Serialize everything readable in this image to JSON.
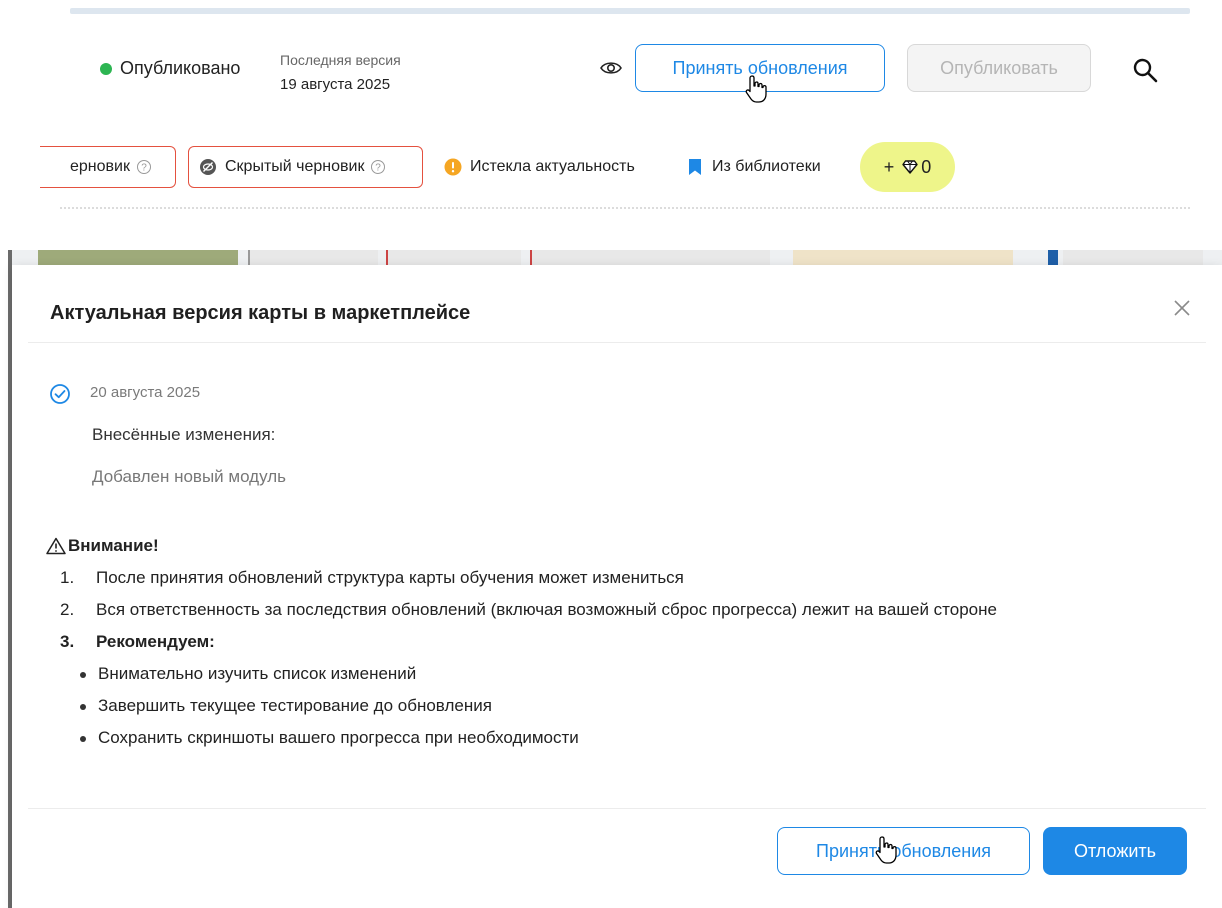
{
  "header": {
    "status_label": "Опубликовано",
    "status_color": "#2db552",
    "version_label": "Последняя версия",
    "version_date": "19 августа 2025",
    "preview_icon": "eye-icon",
    "accept_label": "Принять обновления",
    "publish_label": "Опубликовать",
    "search_icon": "search-icon"
  },
  "chips": {
    "draft_label": "ерновик",
    "hidden_draft_label": "Скрытый черновик",
    "expired_label": "Истекла актуальность",
    "library_label": "Из библиотеки",
    "gems_prefix": "+",
    "gems_count": "0",
    "accent_red": "#e4513f",
    "expired_color": "#f5a623",
    "library_color": "#1e88e5",
    "gems_bg": "#eef58a"
  },
  "modal": {
    "title": "Актуальная версия карты в маркетплейсе",
    "entry_date": "20 августа 2025",
    "changes_label": "Внесённые изменения:",
    "changes_text": "Добавлен новый модуль",
    "warning_title": "Внимание!",
    "items": [
      {
        "num": "1.",
        "text": "После принятия обновлений структура карты обучения может измениться"
      },
      {
        "num": "2.",
        "text": "Вся ответственность за последствия обновлений (включая возможный сброс прогресса) лежит на вашей стороне"
      },
      {
        "num": "3.",
        "text": "Рекомендуем:"
      }
    ],
    "bullets": [
      "Внимательно изучить список изменений",
      "Завершить текущее тестирование до обновления",
      "Сохранить скриншоты вашего прогресса при необходимости"
    ],
    "accept_label": "Принять обновления",
    "postpone_label": "Отложить",
    "primary_color": "#1e88e5"
  }
}
